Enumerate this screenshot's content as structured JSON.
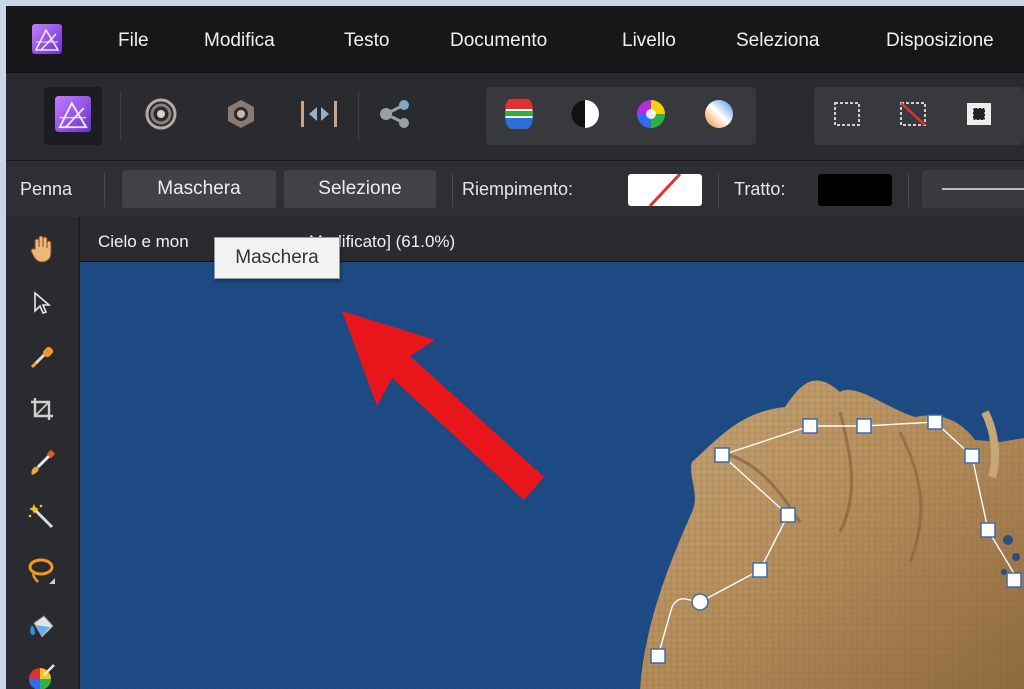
{
  "menubar": {
    "items": [
      "File",
      "Modifica",
      "Testo",
      "Documento",
      "Livello",
      "Seleziona",
      "Disposizione"
    ]
  },
  "contextbar": {
    "tool_name": "Penna",
    "mask_label": "Maschera",
    "selection_label": "Selezione",
    "fill_label": "Riempimento:",
    "stroke_label": "Tratto:",
    "stroke_color": "#000000"
  },
  "document": {
    "tab_title_left": "Cielo e mon",
    "tab_title_right": "Modificato] (61.0%)"
  },
  "tooltip": {
    "text": "Maschera"
  },
  "colors": {
    "canvas_background": "#1d4a83",
    "annotation_arrow": "#e8161b",
    "app_accent": "#a55ff0"
  },
  "icons": {
    "toolbar": [
      "affinity-persona-icon",
      "liquify-persona-icon",
      "develop-persona-icon",
      "tone-mapping-persona-icon",
      "export-persona-icon",
      "auto-levels-icon",
      "auto-contrast-icon",
      "auto-colors-icon",
      "auto-white-balance-icon",
      "marquee-selection-icon",
      "deselect-icon",
      "invert-selection-icon"
    ],
    "tools": [
      "hand-tool-icon",
      "move-tool-icon",
      "color-picker-icon",
      "crop-tool-icon",
      "selection-brush-icon",
      "flood-select-icon",
      "lasso-icon",
      "flood-fill-icon",
      "gradient-icon"
    ]
  }
}
